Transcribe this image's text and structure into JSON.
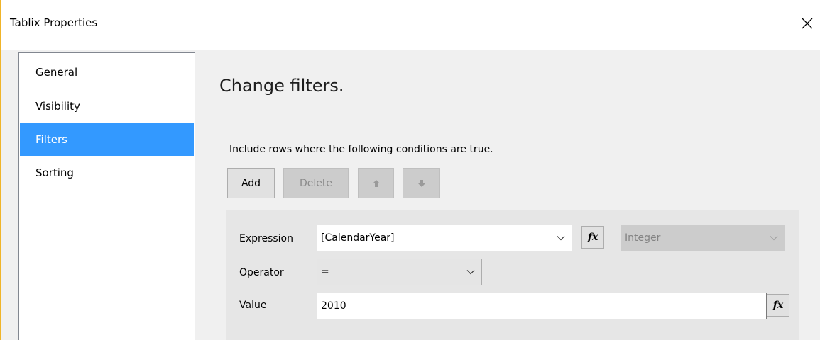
{
  "window": {
    "title": "Tablix Properties"
  },
  "sidebar": {
    "items": [
      {
        "label": "General",
        "selected": false
      },
      {
        "label": "Visibility",
        "selected": false
      },
      {
        "label": "Filters",
        "selected": true
      },
      {
        "label": "Sorting",
        "selected": false
      }
    ]
  },
  "main": {
    "heading": "Change filters.",
    "description": "Include rows where the following conditions are true.",
    "toolbar": {
      "add_label": "Add",
      "delete_label": "Delete"
    },
    "filter": {
      "expression_label": "Expression",
      "expression_value": "[CalendarYear]",
      "type_value": "Integer",
      "operator_label": "Operator",
      "operator_value": "=",
      "value_label": "Value",
      "value_value": "2010"
    }
  },
  "icons": {
    "close": "close-icon",
    "move_up": "arrow-up-icon",
    "move_down": "arrow-down-icon",
    "expression_builder": "fx-icon",
    "dropdown": "chevron-down-icon"
  },
  "colors": {
    "selection": "#3399ff",
    "accent_border": "#f0b429"
  }
}
